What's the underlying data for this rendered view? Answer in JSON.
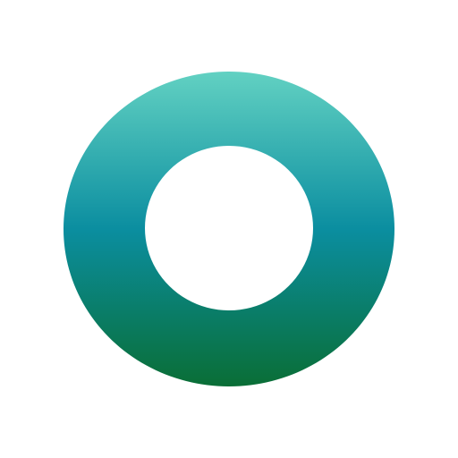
{
  "app_icon": {
    "shape": "ring",
    "colors": {
      "background": "#ffffff",
      "gradient_top": "#62d1c2",
      "gradient_mid": "#0b8ea0",
      "gradient_bottom": "#0a6e36",
      "hole": "#ffffff"
    }
  }
}
